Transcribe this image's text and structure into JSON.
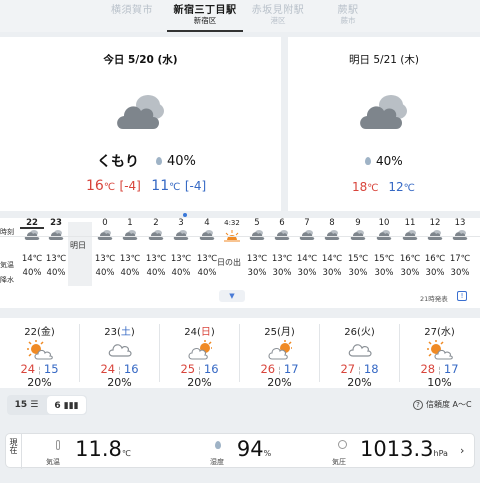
{
  "stations": [
    {
      "name": "横須賀市",
      "ward": ""
    },
    {
      "name": "新宿三丁目駅",
      "ward": "新宿区"
    },
    {
      "name": "赤坂見附駅",
      "ward": "港区"
    },
    {
      "name": "蕨駅",
      "ward": "蕨市"
    }
  ],
  "today": {
    "title": "今日 5/20 (水)",
    "icon": "cloud-icon",
    "condition": "くもり",
    "precip": "40%",
    "high": "16",
    "high_diff": "[-4]",
    "low": "11",
    "low_diff": "[-4]",
    "unit": "℃"
  },
  "tomorrow": {
    "title": "明日 5/21 (木)",
    "icon": "cloud-icon",
    "precip": "40%",
    "high": "18",
    "low": "12",
    "unit": "℃"
  },
  "hourly": {
    "labels": {
      "time": "時刻",
      "temp": "気温",
      "precip": "降水",
      "tomorrow": "明日",
      "sunrise": "日の出"
    },
    "issued": "21時発表",
    "cols": [
      {
        "h": "22",
        "t": "14℃",
        "p": "40%"
      },
      {
        "h": "23",
        "t": "13℃",
        "p": "40%"
      },
      {
        "h": "0",
        "t": "13℃",
        "p": "40%"
      },
      {
        "h": "1",
        "t": "13℃",
        "p": "40%"
      },
      {
        "h": "2",
        "t": "13℃",
        "p": "40%"
      },
      {
        "h": "3",
        "t": "13℃",
        "p": "40%"
      },
      {
        "h": "4",
        "t": "13℃",
        "p": "40%"
      },
      {
        "h": "4:32",
        "t": "",
        "p": ""
      },
      {
        "h": "5",
        "t": "13℃",
        "p": "30%"
      },
      {
        "h": "6",
        "t": "13℃",
        "p": "30%"
      },
      {
        "h": "7",
        "t": "14℃",
        "p": "30%"
      },
      {
        "h": "8",
        "t": "14℃",
        "p": "30%"
      },
      {
        "h": "9",
        "t": "15℃",
        "p": "30%"
      },
      {
        "h": "10",
        "t": "15℃",
        "p": "30%"
      },
      {
        "h": "11",
        "t": "16℃",
        "p": "30%"
      },
      {
        "h": "12",
        "t": "16℃",
        "p": "30%"
      },
      {
        "h": "13",
        "t": "17℃",
        "p": "30%"
      }
    ]
  },
  "weekly": [
    {
      "day": "22(金)",
      "num": "22",
      "wd": "金",
      "wdclass": "",
      "hi": "24",
      "lo": "15",
      "p": "20%",
      "icon": "sun-cloud-icon"
    },
    {
      "day": "23(土)",
      "num": "23",
      "wd": "土",
      "wdclass": "blue",
      "hi": "24",
      "lo": "16",
      "p": "20%",
      "icon": "cloud-icon"
    },
    {
      "day": "24(日)",
      "num": "24",
      "wd": "日",
      "wdclass": "red",
      "hi": "25",
      "lo": "16",
      "p": "20%",
      "icon": "cloud-sun-icon"
    },
    {
      "day": "25(月)",
      "num": "25",
      "wd": "月",
      "wdclass": "",
      "hi": "26",
      "lo": "17",
      "p": "20%",
      "icon": "cloud-sun-icon"
    },
    {
      "day": "26(火)",
      "num": "26",
      "wd": "火",
      "wdclass": "",
      "hi": "27",
      "lo": "18",
      "p": "20%",
      "icon": "cloud-icon"
    },
    {
      "day": "27(水)",
      "num": "27",
      "wd": "水",
      "wdclass": "",
      "hi": "28",
      "lo": "17",
      "p": "10%",
      "icon": "sun-cloud-icon"
    }
  ],
  "range_toggle": {
    "opt1": "15",
    "opt2": "6"
  },
  "reliability": "信頼度 A〜C",
  "current": {
    "label": "現在",
    "temp_label": "気温",
    "temp": "11.8",
    "temp_unit": "℃",
    "hum_label": "湿度",
    "hum": "94",
    "hum_unit": "%",
    "pres_label": "気圧",
    "pres": "1013.3",
    "pres_unit": "hPa"
  },
  "colors": {
    "accent_red": "#d8443b",
    "accent_blue": "#3568c4",
    "sun": "#f08a24"
  }
}
